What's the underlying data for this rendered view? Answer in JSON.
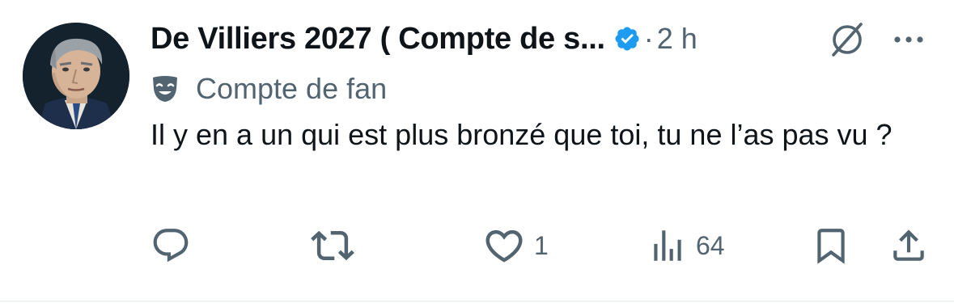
{
  "tweet": {
    "author_name": "De Villiers 2027 ( Compte de s...",
    "separator": "·",
    "time": "2 h",
    "badge_label": "Compte de fan",
    "text": "Il y en a un qui est plus bronzé que toi, tu ne l’as pas vu ?",
    "verified_color": "#1d9bf0",
    "icons": {
      "verified": "verified-badge-icon",
      "grok": "grok-icon",
      "more": "more-icon",
      "badge": "theater-mask-icon"
    }
  },
  "actions": {
    "reply": {
      "icon": "reply-icon",
      "count": ""
    },
    "retweet": {
      "icon": "retweet-icon",
      "count": ""
    },
    "like": {
      "icon": "heart-icon",
      "count": "1"
    },
    "views": {
      "icon": "views-icon",
      "count": "64"
    },
    "bookmark": {
      "icon": "bookmark-icon"
    },
    "share": {
      "icon": "share-icon"
    }
  },
  "colors": {
    "text": "#0f1419",
    "secondary": "#536471",
    "accent": "#1d9bf0",
    "divider": "#eff3f4"
  }
}
